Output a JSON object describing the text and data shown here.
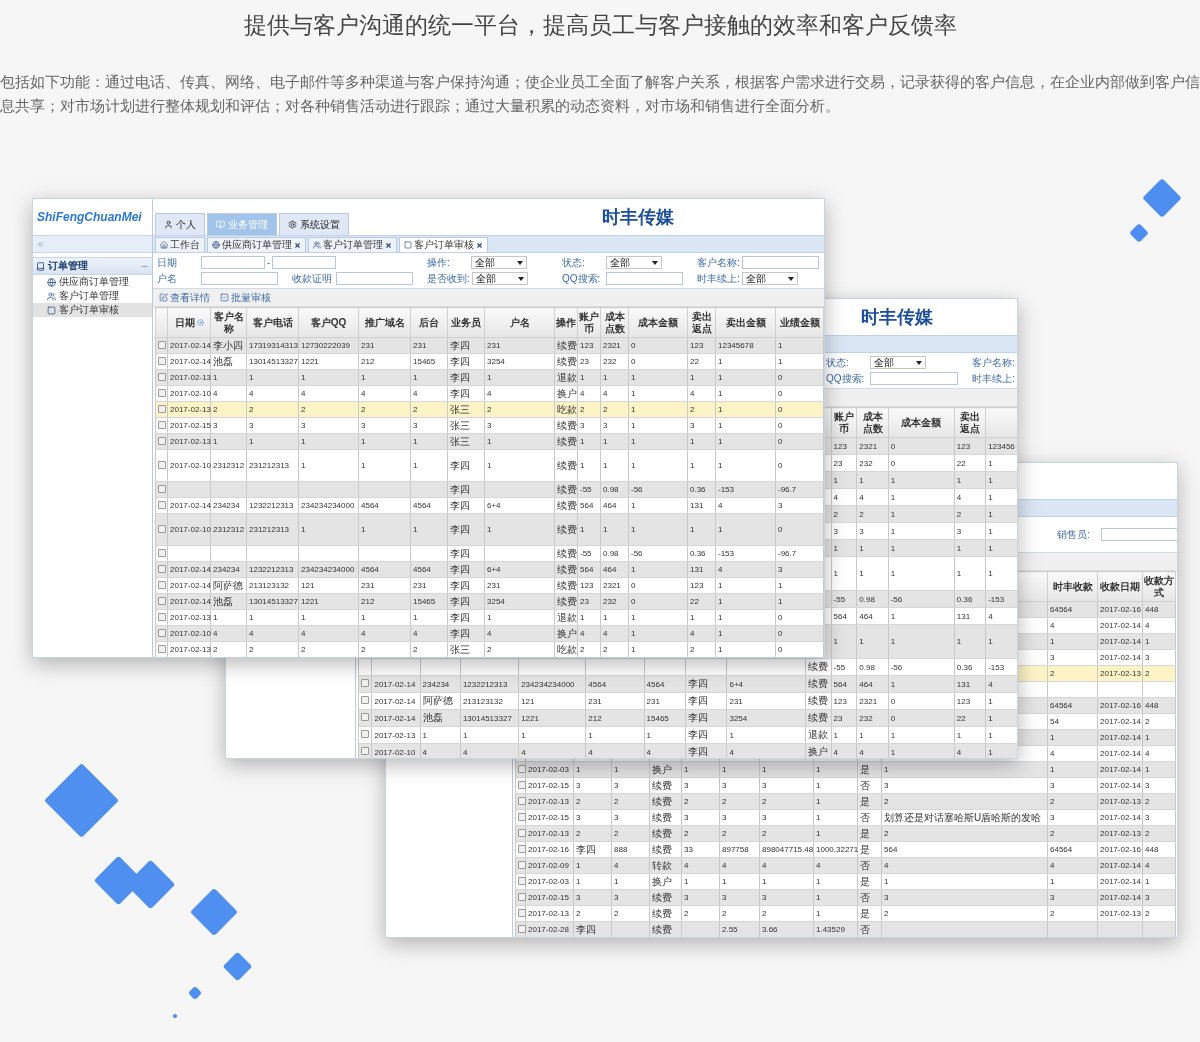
{
  "page": {
    "title": "提供与客户沟通的统一平台，提高员工与客户接触的效率和客户反馈率",
    "intro": "包括如下功能：通过电话、传真、网络、电子邮件等多种渠道与客户保持沟通；使企业员工全面了解客户关系，根据客户需求进行交易，记录获得的客户信息，在企业内部做到客户信息共享；对市场计划进行整体规划和评估；对各种销售活动进行跟踪；通过大量积累的动态资料，对市场和销售进行全面分析。"
  },
  "windows": [
    {
      "brand": "ShiFengChuanMei",
      "title": "时丰传媒",
      "top_tabs": [
        {
          "label": "个人",
          "selected": false
        },
        {
          "label": "业务管理",
          "selected": true
        },
        {
          "label": "系统设置",
          "selected": false
        }
      ],
      "subtabs": [
        {
          "label": "工作台",
          "selected": false,
          "closable": false
        },
        {
          "label": "供应商订单管理",
          "selected": false,
          "closable": true
        },
        {
          "label": "客户订单管理",
          "selected": false,
          "closable": true
        },
        {
          "label": "客户订单审核",
          "selected": true,
          "closable": true
        }
      ],
      "sidebar": {
        "group": "订单管理",
        "items": [
          {
            "label": "供应商订单管理",
            "selected": false
          },
          {
            "label": "客户订单管理",
            "selected": false
          },
          {
            "label": "客户订单审核",
            "selected": true
          }
        ]
      },
      "filters": [
        [
          {
            "label": "日期",
            "kind": "range",
            "separator": "-"
          },
          {
            "label": "操作:",
            "kind": "select",
            "value": "全部"
          },
          {
            "label": "状态:",
            "kind": "select",
            "value": "全部"
          },
          {
            "label": "客户名称:",
            "kind": "text"
          }
        ],
        [
          {
            "label": "户名",
            "kind": "text"
          },
          {
            "label": "收款证明",
            "kind": "text"
          },
          {
            "label": "是否收到:",
            "kind": "select",
            "value": "全部"
          },
          {
            "label": "QQ搜索:",
            "kind": "text"
          },
          {
            "label": "时丰续上:",
            "kind": "select",
            "value": "全部"
          }
        ]
      ],
      "toolbar": [
        {
          "label": "查看详情"
        },
        {
          "label": "批量审核"
        }
      ],
      "columns": [
        "日期",
        "客户名称",
        "客户电话",
        "客户QQ",
        "推广域名",
        "后台",
        "业务员",
        "户名",
        "操作",
        "账户币",
        "成本点数",
        "成本金额",
        "卖出返点",
        "卖出金额",
        "业绩金额"
      ],
      "rows": [
        {
          "checked": false,
          "selected": false,
          "cells": [
            "2017-02-14",
            "李小四",
            "17319314313",
            "12730222039",
            "231",
            "231",
            "李四",
            "231",
            "续费",
            "123",
            "2321",
            "0",
            "123",
            "12345678",
            "1"
          ]
        },
        {
          "checked": false,
          "selected": false,
          "cells": [
            "2017-02-14",
            "池磊",
            "13014513327",
            "1221",
            "212",
            "15465",
            "李四",
            "3254",
            "续费",
            "23",
            "232",
            "0",
            "22",
            "1",
            "1"
          ]
        },
        {
          "checked": false,
          "selected": false,
          "cells": [
            "2017-02-13",
            "1",
            "1",
            "1",
            "1",
            "1",
            "李四",
            "1",
            "退款",
            "1",
            "1",
            "1",
            "1",
            "1",
            "0"
          ]
        },
        {
          "checked": false,
          "selected": false,
          "cells": [
            "2017-02-10",
            "4",
            "4",
            "4",
            "4",
            "4",
            "李四",
            "4",
            "换户",
            "4",
            "4",
            "1",
            "4",
            "1",
            "0"
          ]
        },
        {
          "checked": false,
          "selected": true,
          "cells": [
            "2017-02-13",
            "2",
            "2",
            "2",
            "2",
            "2",
            "张三",
            "2",
            "吃款",
            "2",
            "2",
            "1",
            "2",
            "1",
            "0"
          ]
        },
        {
          "checked": false,
          "selected": false,
          "cells": [
            "2017-02-15",
            "3",
            "3",
            "3",
            "3",
            "3",
            "张三",
            "3",
            "续费",
            "3",
            "3",
            "1",
            "3",
            "1",
            "0"
          ]
        },
        {
          "checked": false,
          "selected": false,
          "cells": [
            "2017-02-13",
            "1",
            "1",
            "1",
            "1",
            "1",
            "张三",
            "1",
            "续费",
            "1",
            "1",
            "1",
            "1",
            "1",
            "0"
          ]
        },
        {
          "checked": false,
          "selected": false,
          "tall": true,
          "cells": [
            "2017-02-10",
            "2312312",
            "231212313",
            "1",
            "1",
            "1",
            "李四",
            "1",
            "续费",
            "1",
            "1",
            "1",
            "1",
            "1",
            "0"
          ]
        },
        {
          "checked": false,
          "selected": false,
          "cells": [
            null,
            null,
            null,
            null,
            null,
            null,
            "李四",
            null,
            "续费",
            "-55",
            "0.98",
            "-56",
            "0.36",
            "-153",
            "-96.7"
          ]
        },
        {
          "checked": false,
          "selected": false,
          "cells": [
            "2017-02-14",
            "234234",
            "1232212313",
            "234234234000",
            "4564",
            "4564",
            "李四",
            "6+4",
            "续费",
            "564",
            "464",
            "1",
            "131",
            "4",
            "3"
          ]
        },
        {
          "checked": false,
          "selected": false,
          "tall": true,
          "cells": [
            "2017-02-10",
            "2312312",
            "231212313",
            "1",
            "1",
            "1",
            "李四",
            "1",
            "续费",
            "1",
            "1",
            "1",
            "1",
            "1",
            "0"
          ]
        },
        {
          "checked": false,
          "selected": false,
          "cells": [
            null,
            null,
            null,
            null,
            null,
            null,
            "李四",
            null,
            "续费",
            "-55",
            "0.98",
            "-56",
            "0.36",
            "-153",
            "-96.7"
          ]
        },
        {
          "checked": false,
          "selected": false,
          "cells": [
            "2017-02-14",
            "234234",
            "1232212313",
            "234234234000",
            "4564",
            "4564",
            "李四",
            "6+4",
            "续费",
            "564",
            "464",
            "1",
            "131",
            "4",
            "3"
          ]
        },
        {
          "checked": false,
          "selected": false,
          "cells": [
            "2017-02-14",
            "阿萨德",
            "213123132",
            "121",
            "231",
            "231",
            "李四",
            "231",
            "续费",
            "123",
            "2321",
            "0",
            "123",
            "1",
            "1"
          ]
        },
        {
          "checked": false,
          "selected": false,
          "cells": [
            "2017-02-14",
            "池磊",
            "13014513327",
            "1221",
            "212",
            "15465",
            "李四",
            "3254",
            "续费",
            "23",
            "232",
            "0",
            "22",
            "1",
            "1"
          ]
        },
        {
          "checked": false,
          "selected": false,
          "cells": [
            "2017-02-13",
            "1",
            "1",
            "1",
            "1",
            "1",
            "李四",
            "1",
            "退款",
            "1",
            "1",
            "1",
            "1",
            "1",
            "0"
          ]
        },
        {
          "checked": false,
          "selected": false,
          "cells": [
            "2017-02-10",
            "4",
            "4",
            "4",
            "4",
            "4",
            "李四",
            "4",
            "换户",
            "4",
            "4",
            "1",
            "4",
            "1",
            "0"
          ]
        },
        {
          "checked": false,
          "selected": false,
          "cells": [
            "2017-02-13",
            "2",
            "2",
            "2",
            "2",
            "2",
            "张三",
            "2",
            "吃款",
            "2",
            "2",
            "1",
            "2",
            "1",
            "0"
          ]
        }
      ]
    },
    {
      "title": "时丰传媒",
      "filters": [
        [
          {
            "label": "状态:",
            "kind": "select",
            "value": "全部"
          },
          {
            "label": "客户名称:",
            "kind": "label"
          }
        ],
        [
          {
            "label": "QQ搜索:",
            "kind": "text"
          },
          {
            "label": "时丰续上:",
            "kind": "label"
          }
        ]
      ],
      "columns": [
        null,
        null,
        null,
        null,
        null,
        null,
        null,
        null,
        null,
        "账户币",
        "成本点数",
        "成本金额",
        "卖出返点",
        null,
        null
      ],
      "rows": [
        {
          "selected": false,
          "cells": [
            null,
            null,
            null,
            null,
            null,
            null,
            null,
            null,
            null,
            "123",
            "2321",
            "0",
            "123",
            "123456",
            null
          ]
        },
        {
          "selected": false,
          "cells": [
            null,
            null,
            null,
            null,
            null,
            null,
            null,
            null,
            null,
            "23",
            "232",
            "0",
            "22",
            "1",
            null
          ]
        },
        {
          "selected": false,
          "cells": [
            null,
            null,
            null,
            null,
            null,
            null,
            null,
            null,
            null,
            "1",
            "1",
            "1",
            "1",
            "1",
            null
          ]
        },
        {
          "selected": false,
          "cells": [
            null,
            null,
            null,
            null,
            null,
            null,
            null,
            null,
            null,
            "4",
            "4",
            "1",
            "4",
            "1",
            null
          ]
        },
        {
          "selected": false,
          "cells": [
            null,
            null,
            null,
            null,
            null,
            null,
            null,
            null,
            null,
            "2",
            "2",
            "1",
            "2",
            "1",
            null
          ]
        },
        {
          "selected": false,
          "cells": [
            null,
            null,
            null,
            null,
            null,
            null,
            null,
            null,
            null,
            "3",
            "3",
            "1",
            "3",
            "1",
            null
          ]
        },
        {
          "selected": false,
          "cells": [
            null,
            null,
            null,
            null,
            null,
            null,
            null,
            null,
            null,
            "1",
            "1",
            "1",
            "1",
            "1",
            null
          ]
        },
        {
          "selected": false,
          "tall": true,
          "cells": [
            null,
            null,
            null,
            null,
            null,
            null,
            null,
            null,
            null,
            "1",
            "1",
            "1",
            "1",
            "1",
            null
          ]
        },
        {
          "selected": false,
          "cells": [
            null,
            null,
            null,
            null,
            null,
            null,
            null,
            null,
            null,
            "-55",
            "0.98",
            "-56",
            "0.36",
            "-153",
            null
          ]
        },
        {
          "selected": false,
          "cells": [
            null,
            null,
            null,
            null,
            null,
            null,
            null,
            null,
            null,
            "564",
            "464",
            "1",
            "131",
            "4",
            null
          ]
        },
        {
          "selected": false,
          "tall": true,
          "cells": [
            null,
            null,
            null,
            null,
            null,
            null,
            null,
            null,
            null,
            "1",
            "1",
            "1",
            "1",
            "1",
            null
          ]
        },
        {
          "selected": false,
          "cells": [
            null,
            null,
            null,
            null,
            null,
            null,
            null,
            null,
            "续费",
            "-55",
            "0.98",
            "-56",
            "0.36",
            "-153",
            null
          ]
        },
        {
          "checked": false,
          "selected": false,
          "cells": [
            "2017-02-14",
            "234234",
            "1232212313",
            "234234234000",
            "4564",
            "4564",
            "李四",
            "6+4",
            "续费",
            "564",
            "464",
            "1",
            "131",
            "4",
            null
          ]
        },
        {
          "checked": false,
          "selected": false,
          "cells": [
            "2017-02-14",
            "阿萨德",
            "213123132",
            "121",
            "231",
            "231",
            "李四",
            "231",
            "续费",
            "123",
            "2321",
            "0",
            "123",
            "1",
            null
          ]
        },
        {
          "checked": false,
          "selected": false,
          "cells": [
            "2017-02-14",
            "池磊",
            "13014513327",
            "1221",
            "212",
            "15465",
            "李四",
            "3254",
            "续费",
            "23",
            "232",
            "0",
            "22",
            "1",
            null
          ]
        },
        {
          "checked": false,
          "selected": false,
          "cells": [
            "2017-02-13",
            "1",
            "1",
            "1",
            "1",
            "1",
            "李四",
            "1",
            "退款",
            "1",
            "1",
            "1",
            "1",
            "1",
            null
          ]
        },
        {
          "checked": false,
          "selected": false,
          "cells": [
            "2017-02-10",
            "4",
            "4",
            "4",
            "4",
            "4",
            "李四",
            "4",
            "换户",
            "4",
            "4",
            "1",
            "4",
            "1",
            null
          ]
        }
      ]
    },
    {
      "filters": [
        [
          {
            "label": "销售员:",
            "kind": "text"
          }
        ]
      ],
      "columns": [
        null,
        null,
        null,
        null,
        null,
        null,
        null,
        null,
        null,
        null,
        "时丰收款",
        "收款日期",
        "收款方式"
      ],
      "rows": [
        {
          "selected": false,
          "cells": [
            null,
            null,
            null,
            null,
            null,
            null,
            null,
            null,
            null,
            null,
            "64564",
            "2017-02-16",
            "448"
          ]
        },
        {
          "selected": false,
          "cells": [
            null,
            null,
            null,
            null,
            null,
            null,
            null,
            null,
            null,
            null,
            "4",
            "2017-02-14",
            "4"
          ]
        },
        {
          "selected": false,
          "cells": [
            null,
            null,
            null,
            null,
            null,
            null,
            null,
            null,
            null,
            null,
            "1",
            "2017-02-14",
            "1"
          ]
        },
        {
          "selected": false,
          "cells": [
            null,
            null,
            null,
            null,
            null,
            null,
            null,
            null,
            null,
            null,
            "3",
            "2017-02-14",
            "3"
          ]
        },
        {
          "selected": true,
          "cells": [
            null,
            null,
            null,
            null,
            null,
            null,
            null,
            null,
            null,
            null,
            "2",
            "2017-02-13",
            "2"
          ]
        },
        {
          "cells": [
            null,
            null,
            null,
            null,
            null,
            null,
            null,
            null,
            null,
            null,
            null,
            null,
            null
          ]
        },
        {
          "selected": false,
          "cells": [
            null,
            null,
            null,
            null,
            null,
            null,
            null,
            null,
            null,
            null,
            "64564",
            "2017-02-16",
            "448"
          ]
        },
        {
          "selected": false,
          "cells": [
            null,
            null,
            null,
            null,
            null,
            null,
            null,
            null,
            null,
            null,
            "54",
            "2017-02-14",
            "2"
          ]
        },
        {
          "selected": false,
          "cells": [
            null,
            null,
            null,
            null,
            null,
            null,
            null,
            null,
            null,
            null,
            "1",
            "2017-02-14",
            "1"
          ]
        },
        {
          "selected": false,
          "cells": [
            null,
            null,
            null,
            null,
            null,
            null,
            null,
            null,
            null,
            null,
            "4",
            "2017-02-14",
            "4"
          ]
        },
        {
          "checked": false,
          "selected": false,
          "cells": [
            "2017-02-03",
            "1",
            "1",
            "换户",
            "1",
            "1",
            "1",
            "1",
            "是",
            "1",
            "1",
            "2017-02-14",
            "1"
          ]
        },
        {
          "checked": false,
          "selected": false,
          "cells": [
            "2017-02-15",
            "3",
            "3",
            "续费",
            "3",
            "3",
            "3",
            "1",
            "否",
            "3",
            "3",
            "2017-02-14",
            "3"
          ]
        },
        {
          "checked": false,
          "selected": false,
          "cells": [
            "2017-02-13",
            "2",
            "2",
            "续费",
            "2",
            "2",
            "2",
            "1",
            "是",
            "2",
            "2",
            "2017-02-13",
            "2"
          ]
        },
        {
          "checked": false,
          "selected": false,
          "cells": [
            "2017-02-15",
            "3",
            "3",
            "续费",
            "3",
            "3",
            "3",
            "1",
            "否",
            "划算还是对话塞哈斯U盾哈斯的发哈",
            "3",
            "2017-02-14",
            "3"
          ]
        },
        {
          "checked": false,
          "selected": false,
          "cells": [
            "2017-02-13",
            "2",
            "2",
            "续费",
            "2",
            "2",
            "2",
            "1",
            "是",
            "2",
            "2",
            "2017-02-13",
            "2"
          ]
        },
        {
          "checked": false,
          "selected": false,
          "cells": [
            "2017-02-16",
            "李四",
            "888",
            "续费",
            "33",
            "897758",
            "898047715.48",
            "1000.32271",
            "是",
            "564",
            "64564",
            "2017-02-16",
            "448"
          ]
        },
        {
          "checked": false,
          "selected": false,
          "cells": [
            "2017-02-09",
            "1",
            "4",
            "转款",
            "4",
            "4",
            "4",
            "4",
            "否",
            "4",
            "4",
            "2017-02-14",
            "4"
          ]
        },
        {
          "checked": false,
          "selected": false,
          "cells": [
            "2017-02-03",
            "1",
            "1",
            "换户",
            "1",
            "1",
            "1",
            "1",
            "是",
            "1",
            "1",
            "2017-02-14",
            "1"
          ]
        },
        {
          "checked": false,
          "selected": false,
          "cells": [
            "2017-02-15",
            "3",
            "3",
            "续费",
            "3",
            "3",
            "3",
            "1",
            "否",
            "3",
            "3",
            "2017-02-14",
            "3"
          ]
        },
        {
          "checked": false,
          "selected": false,
          "cells": [
            "2017-02-13",
            "2",
            "2",
            "续费",
            "2",
            "2",
            "2",
            "1",
            "是",
            "2",
            "2",
            "2017-02-13",
            "2"
          ]
        },
        {
          "checked": false,
          "selected": false,
          "cells": [
            "2017-02-28",
            "李四",
            null,
            "续费",
            null,
            "2.55",
            "3.66",
            "1.43529",
            "否",
            null,
            null,
            null,
            null
          ]
        }
      ]
    }
  ]
}
